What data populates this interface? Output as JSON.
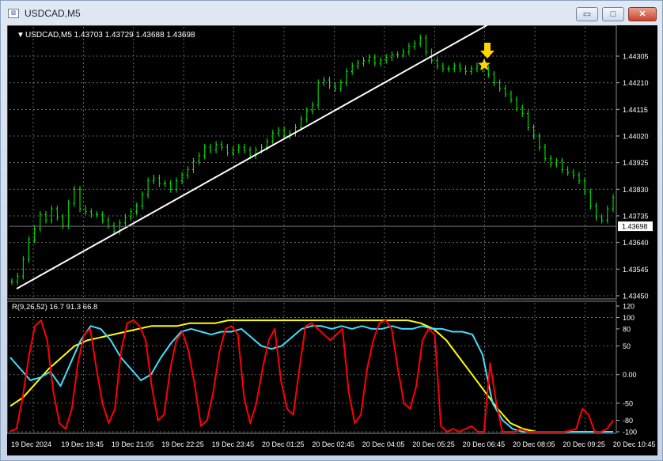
{
  "window": {
    "title": "USDCAD,M5",
    "minimize_glyph": "▭",
    "maximize_glyph": "□",
    "close_glyph": "✕"
  },
  "chart": {
    "header": "USDCAD,M5  1.43703 1.43729 1.43688 1.43698",
    "current_price_label": "1.43698",
    "price_ticks": [
      "1.44305",
      "1.44210",
      "1.44115",
      "1.44020",
      "1.43925",
      "1.43830",
      "1.43735",
      "1.43640",
      "1.43545",
      "1.43450"
    ],
    "time_ticks": [
      "19 Dec 2024",
      "19 Dec 19:45",
      "19 Dec 21:05",
      "19 Dec 22:25",
      "19 Dec 23:45",
      "20 Dec 01:25",
      "20 Dec 02:45",
      "20 Dec 04:05",
      "20 Dec 05:25",
      "20 Dec 06:45",
      "20 Dec 08:05",
      "20 Dec 09:25",
      "20 Dec 10:45"
    ],
    "indicator_header": "R(9,26,52) 16.7 91.3 66.8",
    "indicator_ticks": [
      "120",
      "100",
      "80",
      "50",
      "0.00",
      "-50",
      "-80",
      "-100"
    ],
    "colors": {
      "background": "#000000",
      "candles": "#00ff00",
      "trendline": "#ffffff",
      "grid": "#808080",
      "arrow": "#ffd700",
      "red_line": "#ff0000",
      "cyan_line": "#40e0ff",
      "yellow_line": "#ffff00"
    },
    "icons": {
      "arrow": "down-arrow-icon",
      "star": "star-icon"
    }
  },
  "chart_data": {
    "type": "line",
    "price_series": [
      1.435,
      1.4352,
      1.4358,
      1.4365,
      1.4369,
      1.4374,
      1.4372,
      1.4376,
      1.4373,
      1.437,
      1.4378,
      1.4383,
      1.4376,
      1.4375,
      1.4374,
      1.4374,
      1.4372,
      1.437,
      1.4368,
      1.4371,
      1.4373,
      1.4375,
      1.4377,
      1.4381,
      1.4386,
      1.4387,
      1.4385,
      1.4385,
      1.4383,
      1.4386,
      1.4388,
      1.439,
      1.4393,
      1.4395,
      1.4398,
      1.4397,
      1.4399,
      1.4398,
      1.4396,
      1.4397,
      1.4398,
      1.4397,
      1.4395,
      1.4397,
      1.4398,
      1.44,
      1.4403,
      1.4404,
      1.4402,
      1.4403,
      1.4405,
      1.4408,
      1.4411,
      1.4413,
      1.4421,
      1.4422,
      1.442,
      1.4419,
      1.4421,
      1.4425,
      1.4427,
      1.4428,
      1.4429,
      1.443,
      1.4428,
      1.4429,
      1.443,
      1.4431,
      1.4431,
      1.4432,
      1.4434,
      1.4435,
      1.4437,
      1.4432,
      1.4429,
      1.4427,
      1.4426,
      1.4426,
      1.4427,
      1.4426,
      1.4425,
      1.4426,
      1.4427,
      1.4426,
      1.4424,
      1.4421,
      1.4419,
      1.4417,
      1.4415,
      1.4412,
      1.441,
      1.4405,
      1.4402,
      1.4398,
      1.4394,
      1.4392,
      1.4393,
      1.439,
      1.4389,
      1.4388,
      1.4386,
      1.4382,
      1.4377,
      1.4373,
      1.4372,
      1.4376,
      1.438
    ],
    "trendline": {
      "start": 1.43475,
      "end": 1.445
    },
    "red_series": [
      -99,
      -95,
      -40,
      30,
      85,
      95,
      60,
      -30,
      -85,
      -95,
      -60,
      20,
      70,
      80,
      10,
      -50,
      -85,
      -60,
      40,
      90,
      95,
      85,
      60,
      -20,
      -80,
      -70,
      10,
      60,
      75,
      40,
      -20,
      -90,
      -80,
      -30,
      40,
      80,
      85,
      70,
      -40,
      -85,
      -50,
      10,
      60,
      80,
      -10,
      -60,
      -70,
      10,
      85,
      90,
      80,
      70,
      60,
      70,
      80,
      -30,
      -85,
      -70,
      10,
      60,
      90,
      95,
      80,
      10,
      -50,
      -60,
      -20,
      60,
      80,
      70,
      -90,
      -100,
      -95,
      -100,
      -95,
      -90,
      -100,
      -100,
      20,
      -50,
      -100,
      -100,
      -100,
      -95,
      -100,
      -100,
      -100,
      -100,
      -100,
      -100,
      -100,
      -98,
      -95,
      -60,
      -70,
      -100,
      -100,
      -95,
      -80
    ],
    "cyan_series": [
      30,
      10,
      -10,
      -5,
      5,
      -20,
      20,
      60,
      85,
      80,
      60,
      30,
      10,
      -10,
      0,
      30,
      55,
      75,
      80,
      75,
      70,
      75,
      75,
      80,
      65,
      50,
      45,
      50,
      65,
      80,
      85,
      85,
      80,
      85,
      80,
      85,
      80,
      80,
      85,
      80,
      80,
      85,
      80,
      80,
      75,
      75,
      70,
      35,
      -50,
      -80,
      -95,
      -100,
      -100,
      -100,
      -100,
      -100,
      -100,
      -100,
      -100,
      -100,
      -100
    ],
    "yellow_series": [
      -55,
      -40,
      -15,
      10,
      30,
      50,
      60,
      65,
      70,
      75,
      80,
      85,
      85,
      85,
      90,
      90,
      90,
      95,
      95,
      95,
      95,
      95,
      95,
      95,
      95,
      95,
      95,
      95,
      95,
      95,
      95,
      95,
      90,
      80,
      60,
      30,
      0,
      -30,
      -60,
      -85,
      -95,
      -100,
      -100,
      -100,
      -100,
      -100,
      -100,
      -100
    ],
    "price_range": [
      1.4345,
      1.44305
    ],
    "indicator_range": [
      -100,
      120
    ]
  }
}
